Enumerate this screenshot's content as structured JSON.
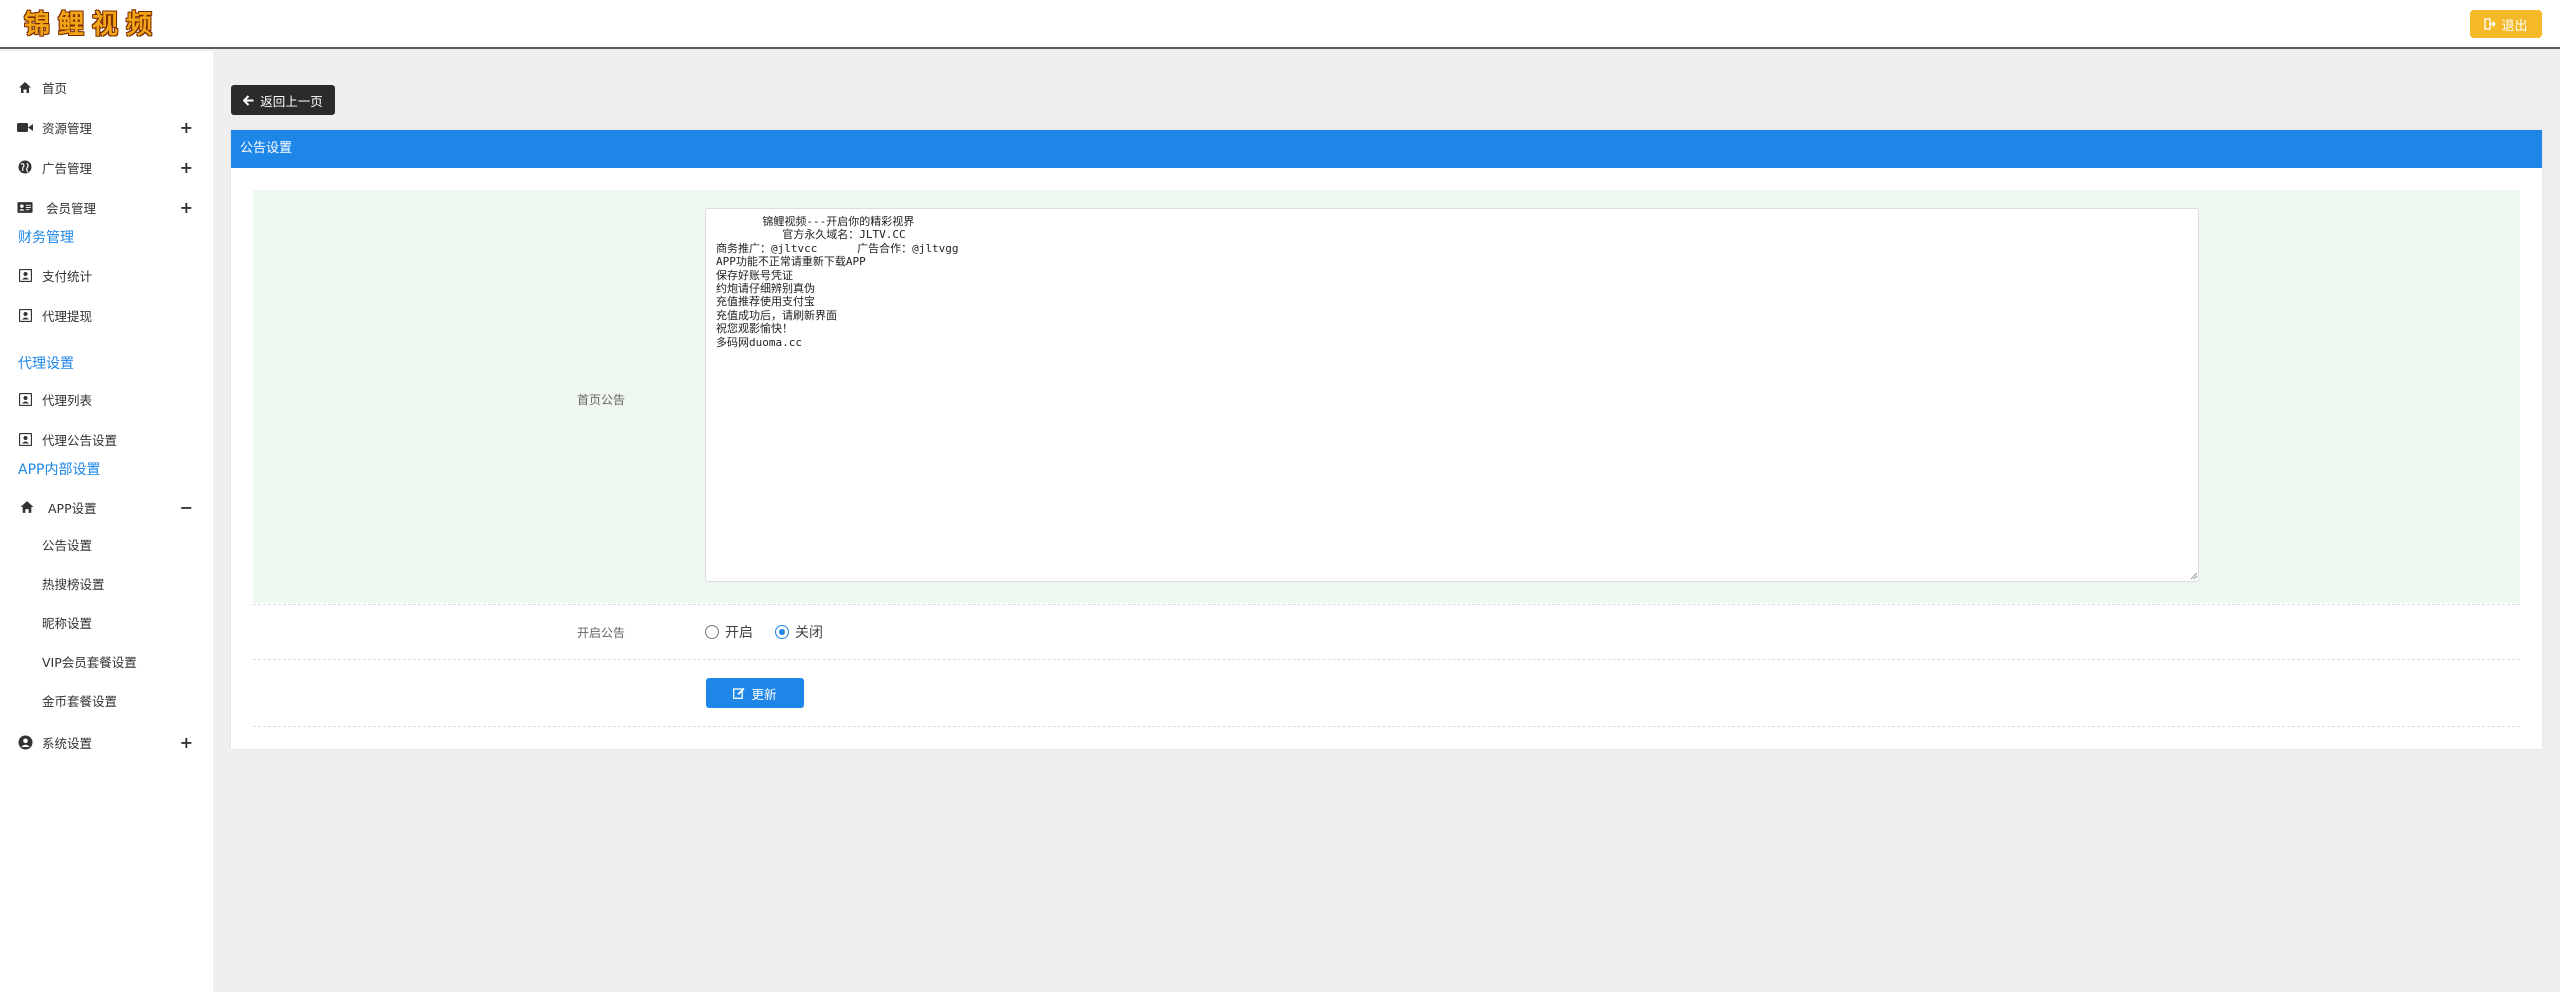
{
  "header": {
    "logo_chars": [
      "锦",
      "鲤",
      "视",
      "频"
    ],
    "logout_label": "退出"
  },
  "sidebar": {
    "items": [
      {
        "label": "首页",
        "icon": "home-icon"
      },
      {
        "label": "资源管理",
        "icon": "video-icon",
        "expander": "+"
      },
      {
        "label": "广告管理",
        "icon": "globe-icon",
        "expander": "+"
      },
      {
        "label": "会员管理",
        "icon": "id-card-icon",
        "expander": "+"
      }
    ],
    "finance": {
      "title": "财务管理",
      "items": [
        {
          "label": "支付统计",
          "icon": "user-square-icon"
        },
        {
          "label": "代理提现",
          "icon": "user-square-icon"
        }
      ]
    },
    "agent": {
      "title": "代理设置",
      "items": [
        {
          "label": "代理列表",
          "icon": "user-square-icon"
        },
        {
          "label": "代理公告设置",
          "icon": "user-square-icon"
        }
      ]
    },
    "app": {
      "title": "APP内部设置",
      "group_label": "APP设置",
      "group_icon": "home-icon",
      "group_expander": "−",
      "sub_items": [
        "公告设置",
        "热搜榜设置",
        "昵称设置",
        "VIP会员套餐设置",
        "金币套餐设置"
      ]
    },
    "system": {
      "label": "系统设置",
      "icon": "user-circle-icon",
      "expander": "+"
    }
  },
  "main": {
    "back_label": "返回上一页",
    "panel_title": "公告设置",
    "notice_label": "首页公告",
    "notice_text": "       锦鲤视频---开启你的精彩视界\n          官方永久域名：JLTV.CC\n商务推广：@jltvcc      广告合作：@jltvgg\nAPP功能不正常请重新下载APP\n保存好账号凭证\n约炮请仔细辨别真伪\n充值推荐使用支付宝\n充值成功后，请刷新界面\n祝您观影愉快！\n多码网duoma.cc",
    "enable_label": "开启公告",
    "radio_options": [
      {
        "label": "开启",
        "checked": false
      },
      {
        "label": "关闭",
        "checked": true
      }
    ],
    "update_label": "更新"
  },
  "colors": {
    "accent": "#1e86e6",
    "logout": "#f4b829",
    "notice_row_bg": "#eef8ee"
  }
}
